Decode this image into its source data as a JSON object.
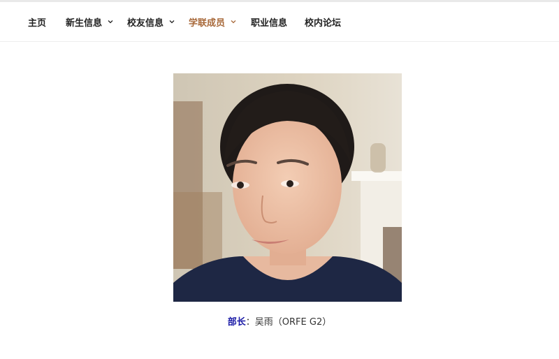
{
  "nav": {
    "items": [
      {
        "label": "主页"
      },
      {
        "label": "新生信息"
      },
      {
        "label": "校友信息"
      },
      {
        "label": "学联成员"
      },
      {
        "label": "职业信息"
      },
      {
        "label": "校内论坛"
      }
    ],
    "active_color": "#a8693a",
    "text_color": "#222222"
  },
  "member": {
    "role": "部长",
    "separator": "：",
    "name": "吴雨（ORFE G2）",
    "role_color": "#1a1aa6"
  }
}
